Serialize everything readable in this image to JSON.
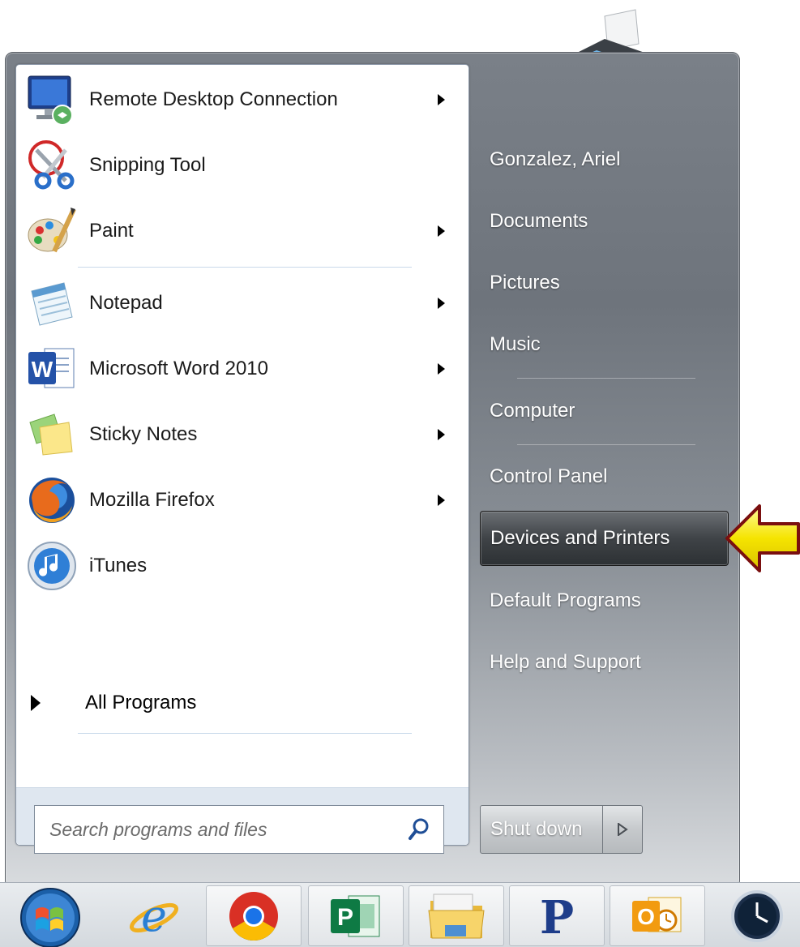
{
  "programs": [
    {
      "label": "Remote Desktop Connection",
      "icon": "remote-desktop-icon",
      "has_submenu": true
    },
    {
      "label": "Snipping Tool",
      "icon": "scissors-icon",
      "has_submenu": false
    },
    {
      "label": "Paint",
      "icon": "paint-palette-icon",
      "has_submenu": true
    },
    {
      "label": "Notepad",
      "icon": "notepad-icon",
      "has_submenu": true
    },
    {
      "label": "Microsoft Word 2010",
      "icon": "word-icon",
      "has_submenu": true
    },
    {
      "label": "Sticky Notes",
      "icon": "sticky-notes-icon",
      "has_submenu": true
    },
    {
      "label": "Mozilla Firefox",
      "icon": "firefox-icon",
      "has_submenu": true
    },
    {
      "label": "iTunes",
      "icon": "itunes-icon",
      "has_submenu": false
    }
  ],
  "all_programs_label": "All Programs",
  "search": {
    "placeholder": "Search programs and files"
  },
  "right_items": [
    {
      "label": "Gonzalez, Ariel"
    },
    {
      "label": "Documents"
    },
    {
      "label": "Pictures"
    },
    {
      "label": "Music"
    },
    {
      "label": "Computer"
    },
    {
      "label": "Control Panel"
    },
    {
      "label": "Devices and Printers",
      "highlighted": true
    },
    {
      "label": "Default Programs"
    },
    {
      "label": "Help and Support"
    }
  ],
  "shutdown_label": "Shut down",
  "taskbar_items": [
    "start-orb-icon",
    "internet-explorer-icon",
    "chrome-icon",
    "publisher-icon",
    "file-explorer-icon",
    "p-app-icon",
    "outlook-icon",
    "clock-icon"
  ],
  "colors": {
    "highlight_arrow": "#f5e400",
    "highlight_arrow_border": "#7a0f0f",
    "start_text": "#ffffff"
  }
}
